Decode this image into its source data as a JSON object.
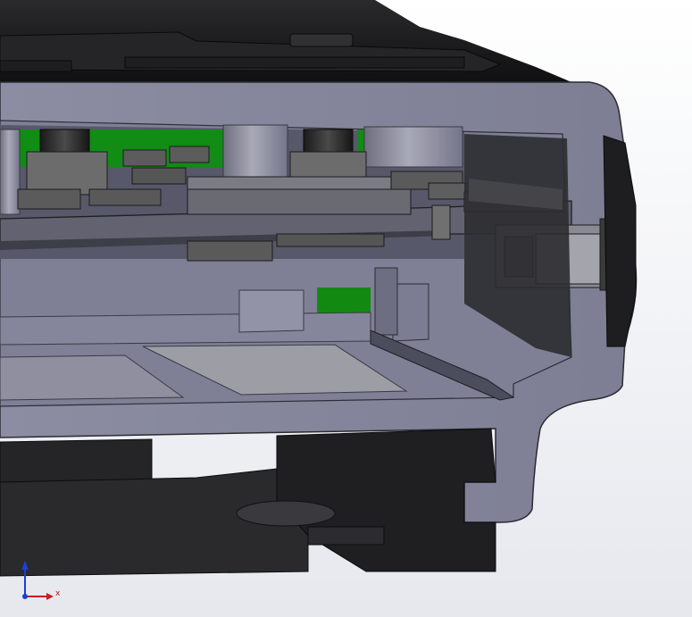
{
  "view": {
    "background_top": "#ffffff",
    "background_bottom": "#e6e8ee",
    "colors": {
      "housing": "#8e8fa3",
      "housing_shade": "#6f7086",
      "housing_dark": "#55566a",
      "pcb_dark": "#3c3c3c",
      "component": "#5e5e5e",
      "component_light": "#7a7a7a",
      "green_pcb": "#128a12",
      "black_part": "#1c1c1c",
      "tray": "#9a9aa2"
    }
  },
  "triad": {
    "x_label": "x",
    "x_color": "#c81e1e",
    "y_color": "#1c3fd0"
  }
}
